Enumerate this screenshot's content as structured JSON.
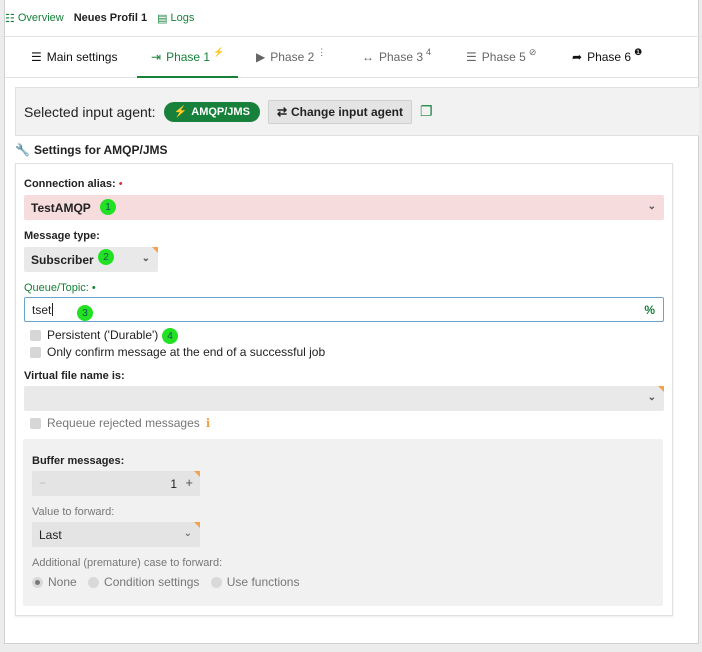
{
  "topbar": {
    "overview": "Overview",
    "profile": "Neues Profil 1",
    "logs": "Logs"
  },
  "tabs": [
    {
      "label": "Main settings",
      "icon": "list-icon",
      "sup": ""
    },
    {
      "label": "Phase 1",
      "icon": "arrow-right-icon",
      "sup": "⚡"
    },
    {
      "label": "Phase 2",
      "icon": "edit-icon",
      "sup": "⋮"
    },
    {
      "label": "Phase 3",
      "icon": "swap-icon",
      "sup": "4"
    },
    {
      "label": "Phase 5",
      "icon": "server-icon",
      "sup": "⊘"
    },
    {
      "label": "Phase 6",
      "icon": "share-icon",
      "sup": "❶"
    }
  ],
  "agent": {
    "label": "Selected input agent:",
    "pill": "AMQP/JMS",
    "change_button": "Change input agent"
  },
  "settings_title": "Settings for AMQP/JMS",
  "form": {
    "connection_alias_label": "Connection alias:",
    "connection_alias_value": "TestAMQP",
    "message_type_label": "Message type:",
    "message_type_value": "Subscriber",
    "queue_label": "Queue/Topic:",
    "queue_value": "tset",
    "persistent_label": "Persistent ('Durable')",
    "confirm_label": "Only confirm message at the end of a successful job",
    "virtual_file_label": "Virtual file name is:",
    "requeue_label": "Requeue rejected messages",
    "buffer_label": "Buffer messages:",
    "buffer_value": "1",
    "value_forward_label": "Value to forward:",
    "value_forward_value": "Last",
    "additional_label": "Additional (premature) case to forward:",
    "radio_none": "None",
    "radio_condition": "Condition settings",
    "radio_functions": "Use functions"
  },
  "badges": [
    "1",
    "2",
    "3",
    "4"
  ],
  "colors": {
    "accent": "#17803b",
    "error_bg": "#f6dcdc",
    "badge": "#22e022"
  }
}
